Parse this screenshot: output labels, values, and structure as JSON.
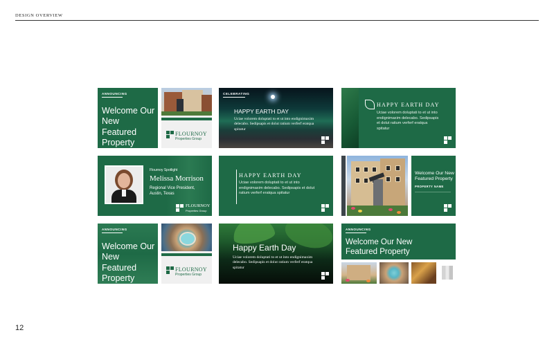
{
  "header": {
    "title": "DESIGN OVERVIEW"
  },
  "page_number": "12",
  "colors": {
    "brand_green": "#1e6a46",
    "dark": "#0d1e22",
    "white": "#ffffff"
  },
  "cards": {
    "c1": {
      "tag": "ANNOUNCING",
      "headline": "Welcome Our New Featured Property",
      "logo_name": "FLOURNOY",
      "logo_sub": "Properties Group"
    },
    "c2": {
      "tag": "CELEBRATING",
      "headline": "HAPPY EARTH DAY",
      "body": "Uciae volorem doluptati to et ut into endignimaxim delecabo. Sedipsapis et dolut ratium verferf eratqua spitatur"
    },
    "c3": {
      "headline": "HAPPY EARTH DAY",
      "body": "Uciae volorem doluptati to et ut into endignimaxim delecabo. Sedipsapis et dolut ratium verferf eratqua spitatur"
    },
    "c4": {
      "kicker": "Flournoy Spotlight",
      "name": "Melissa Morrison",
      "role": "Regional Vice President,",
      "location": "Austin, Texas",
      "logo_name": "FLOURNOY",
      "logo_sub": "Properties Group"
    },
    "c5": {
      "headline": "HAPPY EARTH DAY",
      "body": "Uciae volorem doluptati to et ut into endignimaxim delecabo. Sedipsapis et dolut ratium verferf eratqua spitatur"
    },
    "c6": {
      "headline": "Welcome Our New Featured Property",
      "sub": "PROPERTY NAME"
    },
    "c7": {
      "tag": "ANNOUNCING",
      "headline": "Welcome Our New Featured Property",
      "logo_name": "FLOURNOY",
      "logo_sub": "Properties Group"
    },
    "c8": {
      "headline": "Happy Earth Day",
      "body": "Uciae volorem doluptati to et ut into endignimaxim delecabo. Sedipsapis et dolut ratium verferf eratqua spitatur"
    },
    "c9": {
      "tag": "ANNOUNCING",
      "headline": "Welcome Our New Featured Property"
    }
  }
}
